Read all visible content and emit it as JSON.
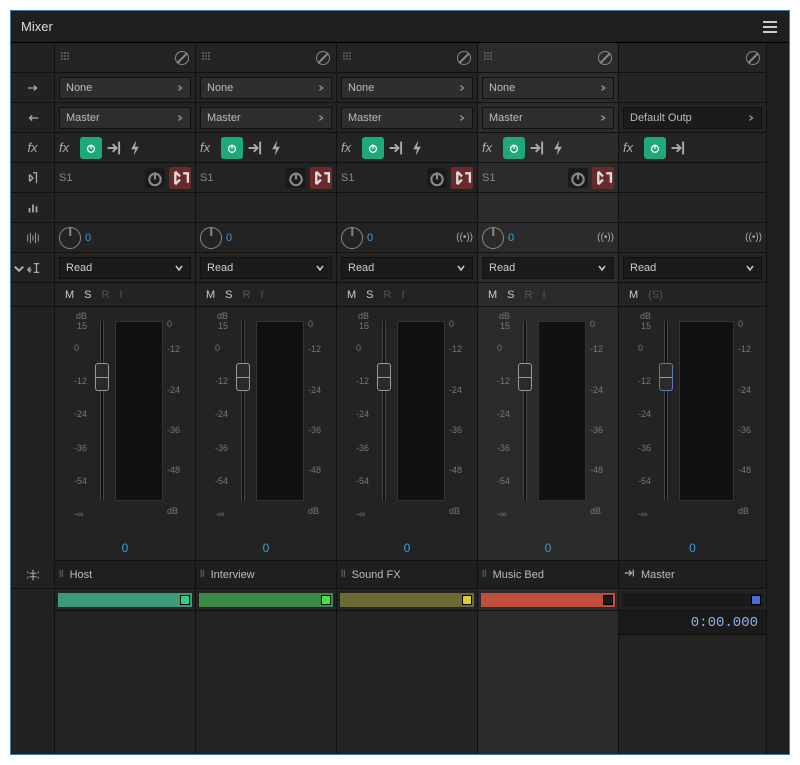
{
  "panel": {
    "title": "Mixer"
  },
  "tracks": [
    {
      "input": "None",
      "output": "Master",
      "send": "S1",
      "pan": "0",
      "automation": "Read",
      "msri": {
        "m": "M",
        "s": "S",
        "r": "R",
        "i": "I"
      },
      "volume": "0",
      "name": "Host",
      "color": "#3a9a78",
      "swatch": "#2ed08a",
      "active": false,
      "hasMono": false
    },
    {
      "input": "None",
      "output": "Master",
      "send": "S1",
      "pan": "0",
      "automation": "Read",
      "msri": {
        "m": "M",
        "s": "S",
        "r": "R",
        "i": "I"
      },
      "volume": "0",
      "name": "Interview",
      "color": "#3a8a48",
      "swatch": "#49e049",
      "active": false,
      "hasMono": false
    },
    {
      "input": "None",
      "output": "Master",
      "send": "S1",
      "pan": "0",
      "automation": "Read",
      "msri": {
        "m": "M",
        "s": "S",
        "r": "R",
        "i": "I"
      },
      "volume": "0",
      "name": "Sound FX",
      "color": "#6b6a32",
      "swatch": "#d8d037",
      "active": false,
      "hasMono": true
    },
    {
      "input": "None",
      "output": "Master",
      "send": "S1",
      "pan": "0",
      "automation": "Read",
      "msri": {
        "m": "M",
        "s": "S",
        "r": "R",
        "i": "I"
      },
      "volume": "0",
      "name": "Music Bed",
      "color": "#c24d3a",
      "swatch": "#1a1a1a",
      "active": true,
      "hasMono": true
    }
  ],
  "master": {
    "output": "Default Outp",
    "automation": "Read",
    "ms": {
      "m": "M",
      "s": "(S)"
    },
    "volume": "0",
    "name": "Master",
    "time": "0:00.000",
    "color": "#1a1a1a",
    "swatch": "#4a6ad8",
    "hasMono": true
  },
  "scaleLeft": {
    "top1": "dB",
    "top2": "15",
    "vals": [
      "0",
      "-12",
      "-24",
      "-36",
      "-54",
      "-∞"
    ]
  },
  "scaleRight": {
    "top": "0",
    "vals": [
      "-12",
      "-24",
      "-36",
      "-48",
      "dB"
    ]
  }
}
